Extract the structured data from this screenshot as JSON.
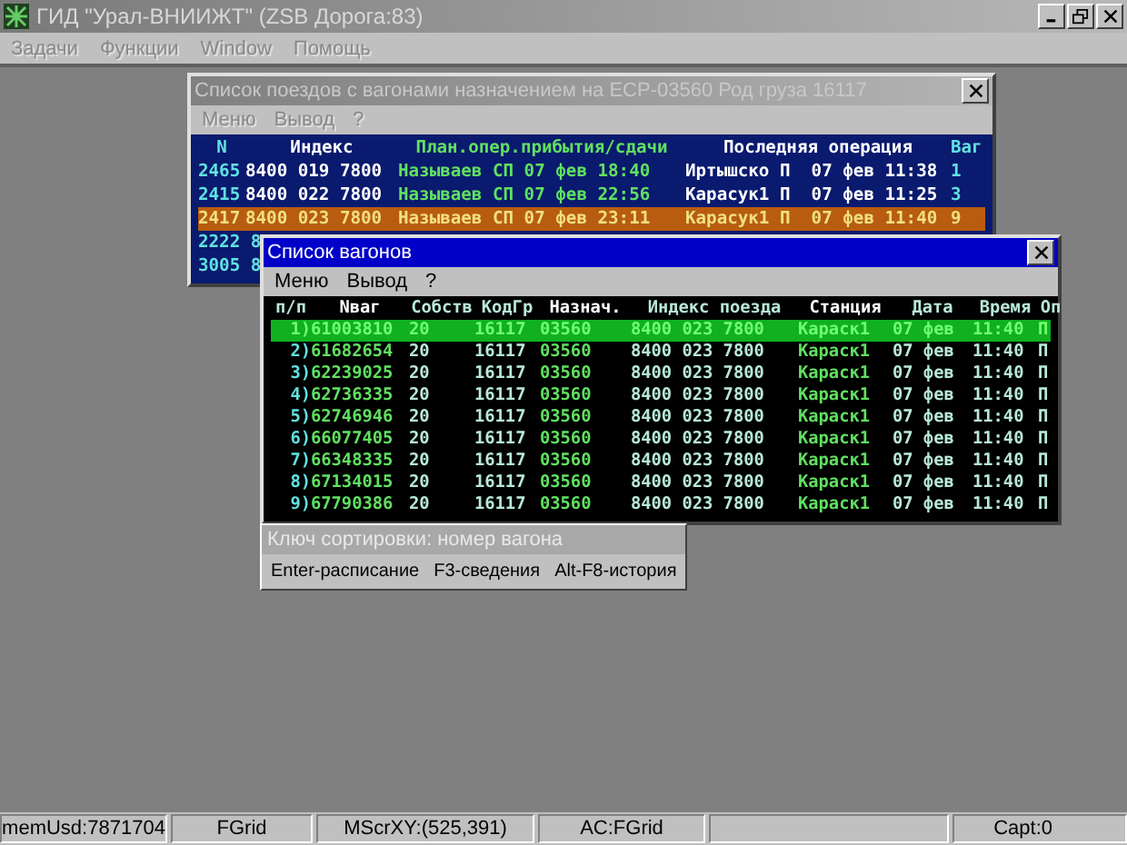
{
  "window": {
    "title": "ГИД \"Урал-ВНИИЖТ\" (ZSB Дорога:83)"
  },
  "menu": [
    {
      "label": "Задачи",
      "disabled": true
    },
    {
      "label": "Функции",
      "disabled": true
    },
    {
      "label": "Window",
      "disabled": true
    },
    {
      "label": "Помощь",
      "disabled": true
    }
  ],
  "train_window": {
    "title": "Список поездов с вагонами назначением на ЕСР-03560 Род груза 16117",
    "active": false,
    "menu": [
      {
        "label": "Меню",
        "disabled": true
      },
      {
        "label": "Вывод",
        "disabled": true
      },
      {
        "label": "?",
        "disabled": true
      }
    ],
    "columns": [
      "N",
      "Индекс",
      "План.опер.прибытия/сдачи",
      "Последняя операция",
      "Ваг"
    ],
    "rows": [
      {
        "selected": false,
        "cells": [
          "2465",
          "8400 019 7800",
          "Называев СП 07 фев 18:40",
          "Иртышско П  07 фев 11:38",
          "1"
        ]
      },
      {
        "selected": false,
        "cells": [
          "2415",
          "8400 022 7800",
          "Называев СП 07 фев 22:56",
          "Карасук1 П  07 фев 11:25",
          "3"
        ]
      },
      {
        "selected": true,
        "cells": [
          "2417",
          "8400 023 7800",
          "Называев СП 07 фев 23:11",
          "Карасук1 П  07 фев 11:40",
          "9"
        ]
      },
      {
        "selected": false,
        "cells": [
          "2222 8"
        ]
      },
      {
        "selected": false,
        "cells": [
          "3005 8"
        ]
      }
    ]
  },
  "wagon_window": {
    "title": "Список вагонов",
    "active": true,
    "menu": [
      {
        "label": "Меню",
        "disabled": false
      },
      {
        "label": "Вывод",
        "disabled": false
      },
      {
        "label": "?",
        "disabled": false
      }
    ],
    "columns": [
      "п/п",
      "Nваг",
      "Собств",
      "КодГр",
      "Назнач.",
      "Индекс поезда",
      "Станция",
      "Дата",
      "Время",
      "Оп"
    ],
    "rows": [
      {
        "selected": true,
        "cells": [
          "1)",
          "61003810",
          "20",
          "16117",
          "03560",
          "8400 023 7800",
          "Караск1",
          "07 фев",
          "11:40",
          "П"
        ]
      },
      {
        "selected": false,
        "cells": [
          "2)",
          "61682654",
          "20",
          "16117",
          "03560",
          "8400 023 7800",
          "Караск1",
          "07 фев",
          "11:40",
          "П"
        ]
      },
      {
        "selected": false,
        "cells": [
          "3)",
          "62239025",
          "20",
          "16117",
          "03560",
          "8400 023 7800",
          "Караск1",
          "07 фев",
          "11:40",
          "П"
        ]
      },
      {
        "selected": false,
        "cells": [
          "4)",
          "62736335",
          "20",
          "16117",
          "03560",
          "8400 023 7800",
          "Караск1",
          "07 фев",
          "11:40",
          "П"
        ]
      },
      {
        "selected": false,
        "cells": [
          "5)",
          "62746946",
          "20",
          "16117",
          "03560",
          "8400 023 7800",
          "Караск1",
          "07 фев",
          "11:40",
          "П"
        ]
      },
      {
        "selected": false,
        "cells": [
          "6)",
          "66077405",
          "20",
          "16117",
          "03560",
          "8400 023 7800",
          "Караск1",
          "07 фев",
          "11:40",
          "П"
        ]
      },
      {
        "selected": false,
        "cells": [
          "7)",
          "66348335",
          "20",
          "16117",
          "03560",
          "8400 023 7800",
          "Караск1",
          "07 фев",
          "11:40",
          "П"
        ]
      },
      {
        "selected": false,
        "cells": [
          "8)",
          "67134015",
          "20",
          "16117",
          "03560",
          "8400 023 7800",
          "Караск1",
          "07 фев",
          "11:40",
          "П"
        ]
      },
      {
        "selected": false,
        "cells": [
          "9)",
          "67790386",
          "20",
          "16117",
          "03560",
          "8400 023 7800",
          "Караск1",
          "07 фев",
          "11:40",
          "П"
        ]
      }
    ]
  },
  "sort_panel": {
    "title": "Ключ сортировки: номер вагона",
    "hints": [
      "Enter-расписание",
      "F3-сведения",
      "Alt-F8-история"
    ]
  },
  "status_bar": [
    {
      "kind": "text",
      "text": "memUsd:7871704"
    },
    {
      "kind": "text",
      "text": "FGrid"
    },
    {
      "kind": "text",
      "text": "MScrXY:(525,391)"
    },
    {
      "kind": "text",
      "text": "AC:FGrid"
    },
    {
      "kind": "blank"
    },
    {
      "kind": "text",
      "text": "Capt:0"
    }
  ]
}
